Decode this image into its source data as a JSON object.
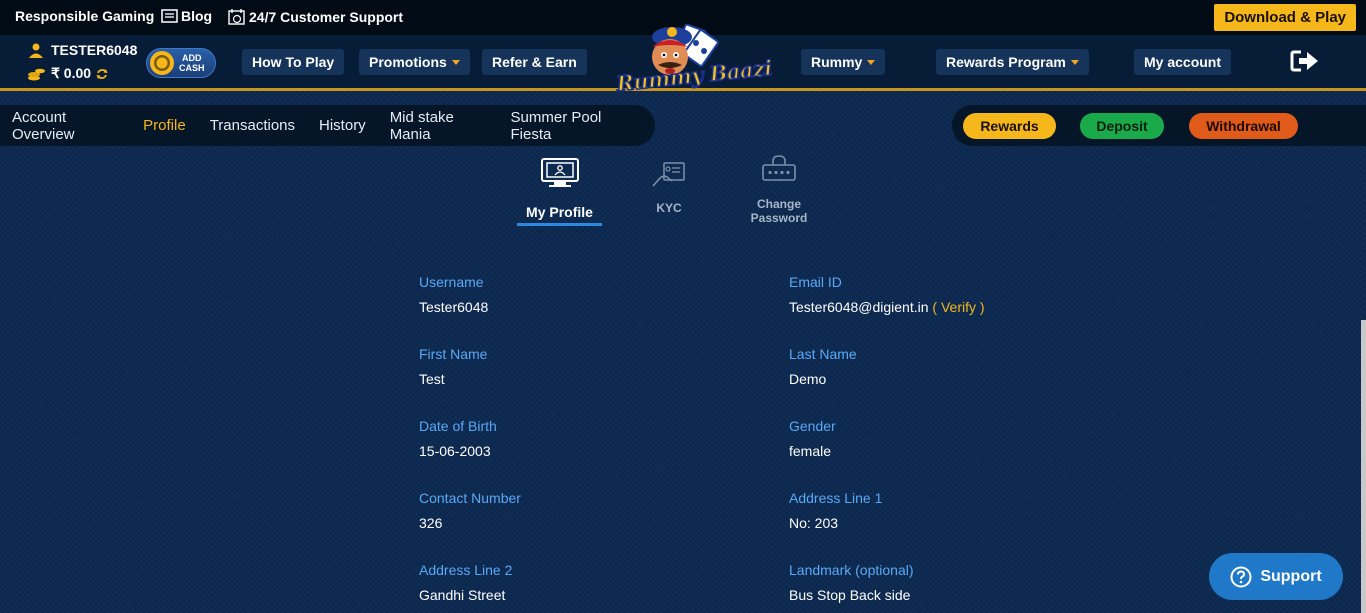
{
  "topbar": {
    "responsible_gaming": "Responsible Gaming",
    "blog": "Blog",
    "support": "24/7 Customer Support",
    "download": "Download & Play"
  },
  "user": {
    "name": "TESTER6048",
    "balance": "₹ 0.00",
    "add_cash_line1": "ADD",
    "add_cash_line2": "CASH"
  },
  "nav": {
    "how_to_play": "How To Play",
    "promotions": "Promotions",
    "refer_earn": "Refer & Earn",
    "logo_text": "Rummy Baazi",
    "rummy": "Rummy",
    "rewards_program": "Rewards Program",
    "my_account": "My account"
  },
  "subnav": {
    "items": [
      "Account Overview",
      "Profile",
      "Transactions",
      "History",
      "Mid stake Mania",
      "Summer Pool Fiesta"
    ],
    "active": "Profile"
  },
  "actions": {
    "rewards": "Rewards",
    "deposit": "Deposit",
    "withdrawal": "Withdrawal"
  },
  "profile_tabs": {
    "my_profile": "My Profile",
    "kyc": "KYC",
    "change_password_1": "Change",
    "change_password_2": "Password"
  },
  "fields": {
    "username_label": "Username",
    "username": "Tester6048",
    "email_label": "Email ID",
    "email": "Tester6048@digient.in",
    "verify": "( Verify )",
    "first_name_label": "First Name",
    "first_name": "Test",
    "last_name_label": "Last Name",
    "last_name": "Demo",
    "dob_label": "Date of Birth",
    "dob": "15-06-2003",
    "gender_label": "Gender",
    "gender": "female",
    "contact_label": "Contact Number",
    "contact": "326",
    "address1_label": "Address Line 1",
    "address1": "No: 203",
    "address2_label": "Address Line 2",
    "address2": "Gandhi Street",
    "landmark_label": "Landmark (optional)",
    "landmark": "Bus Stop Back side"
  },
  "support_widget": {
    "label": "Support"
  },
  "colors": {
    "accent": "#f5b71a",
    "deposit": "#1aaa4a",
    "withdrawal": "#e05a1a",
    "label": "#5aa9f5"
  }
}
